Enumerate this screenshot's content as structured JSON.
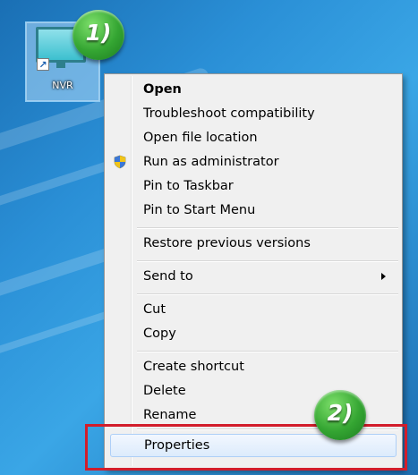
{
  "desktop_icon": {
    "label": "NVR",
    "icon": "nvr-monitor-icon"
  },
  "steps": {
    "step1": "1)",
    "step2": "2)"
  },
  "menu": {
    "items": [
      {
        "label": "Open",
        "bold": true
      },
      {
        "label": "Troubleshoot compatibility"
      },
      {
        "label": "Open file location"
      },
      {
        "label": "Run as administrator",
        "icon": "uac-shield-icon"
      },
      {
        "label": "Pin to Taskbar"
      },
      {
        "label": "Pin to Start Menu"
      },
      {
        "label": "Restore previous versions"
      },
      {
        "label": "Send to",
        "submenu": true
      },
      {
        "label": "Cut"
      },
      {
        "label": "Copy"
      },
      {
        "label": "Create shortcut"
      },
      {
        "label": "Delete"
      },
      {
        "label": "Rename"
      },
      {
        "label": "Properties",
        "highlighted": true
      }
    ]
  },
  "colors": {
    "desktop_bg": "#2a8fd6",
    "menu_bg": "#f0f0f0",
    "highlight_border": "#aecff7",
    "callout_red": "#d21d2b",
    "badge_green": "#34a532"
  }
}
